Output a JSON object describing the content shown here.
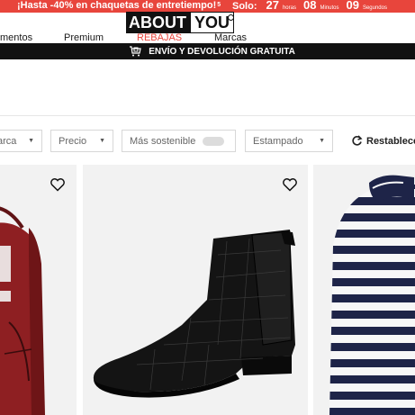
{
  "promo": {
    "message": "¡Hasta -40% en chaquetas de entretiempo!",
    "message_sup": "5",
    "solo_label": "Solo:",
    "countdown": [
      {
        "value": "27",
        "unit": "horas"
      },
      {
        "value": "08",
        "unit": "Minutos"
      },
      {
        "value": "09",
        "unit": "Segundos"
      }
    ]
  },
  "logo": {
    "part1": "ABOUT",
    "part2": "YOU"
  },
  "nav": {
    "item1": "mentos",
    "item2": "Premium",
    "item3": "REBAJAS",
    "item4": "Marcas"
  },
  "shipping_banner": "ENVÍO Y DEVOLUCIÓN GRATUITA",
  "filters": {
    "brand": "arca",
    "price": "Precio",
    "sustainable": "Más sostenible",
    "pattern": "Estampado",
    "reset": "Restablece"
  },
  "colors": {
    "promo_red": "#e8453c",
    "black": "#111111",
    "card_bg": "#f2f2f2"
  },
  "products": [
    {
      "name": "backpack",
      "icon": "heart-outline-icon"
    },
    {
      "name": "chelsea-boot",
      "icon": "heart-outline-icon"
    },
    {
      "name": "striped-sweater"
    }
  ]
}
